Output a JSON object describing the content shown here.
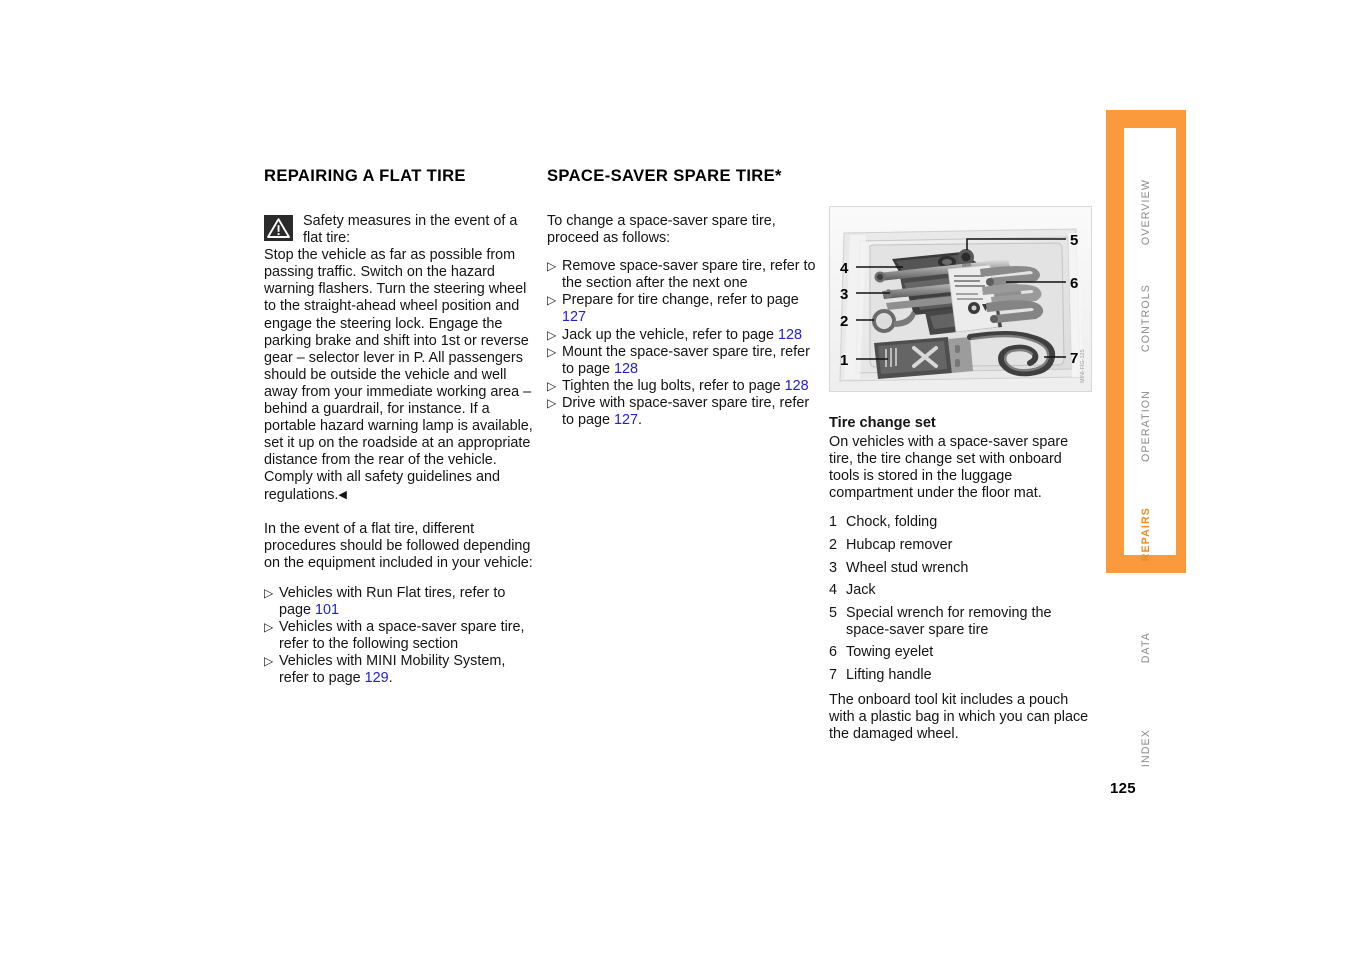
{
  "page": {
    "number": "125"
  },
  "column_1": {
    "title": "REPAIRING A FLAT TIRE",
    "warning": {
      "icon": "warning-triangle-icon",
      "lead": "Safety measures in the event of a flat tire:",
      "body": "Stop the vehicle as far as possible from passing traffic. Switch on the hazard warning flashers.\nTurn the steering wheel to the straight-ahead wheel position and engage the steering lock. Engage the parking brake and shift into 1st or reverse gear – selector lever in P.\nAll passengers should be outside the vehicle and well away from your immediate working area – behind a guardrail, for instance.\nIf a portable hazard warning lamp is available, set it up on the roadside at an appropriate distance from the rear of the vehicle. Comply with all safety guidelines and regulations.",
      "end_marker": "◀"
    },
    "intro": "In the event of a flat tire, different procedures should be followed depending on the equipment included in your vehicle:",
    "bullet_marker": "▷",
    "items": [
      {
        "text_before": "Vehicles with Run Flat tires, refer to page ",
        "link": "101",
        "text_after": ""
      },
      {
        "text_before": "Vehicles with a space-saver spare tire, refer to the following section",
        "link": "",
        "text_after": ""
      },
      {
        "text_before": "Vehicles with MINI Mobility System, refer to page ",
        "link": "129",
        "text_after": "."
      }
    ]
  },
  "column_2": {
    "title": "SPACE-SAVER SPARE TIRE*",
    "intro": "To change a space-saver spare tire, proceed as follows:",
    "bullet_marker": "▷",
    "items": [
      {
        "text_before": "Remove space-saver spare tire, refer to the section after the next one",
        "link": "",
        "text_after": ""
      },
      {
        "text_before": "Prepare for tire change, refer to page ",
        "link": "127",
        "text_after": ""
      },
      {
        "text_before": "Jack up the vehicle, refer to page ",
        "link": "128",
        "text_after": ""
      },
      {
        "text_before": "Mount the space-saver spare tire, refer to page ",
        "link": "128",
        "text_after": ""
      },
      {
        "text_before": "Tighten the lug bolts, refer to page ",
        "link": "128",
        "text_after": ""
      },
      {
        "text_before": "Drive with space-saver spare tire, refer to page ",
        "link": "127",
        "text_after": "."
      }
    ]
  },
  "column_3": {
    "figure": {
      "name": "tire-change-set-photo",
      "callouts": [
        "1",
        "2",
        "3",
        "4",
        "5",
        "6",
        "7"
      ]
    },
    "subtitle": "Tire change set",
    "intro": "On vehicles with a space-saver spare tire, the tire change set with onboard tools is stored in the luggage compartment under the floor mat.",
    "legend": [
      {
        "num": "1",
        "label": "Chock, folding"
      },
      {
        "num": "2",
        "label": "Hubcap remover"
      },
      {
        "num": "3",
        "label": "Wheel stud wrench"
      },
      {
        "num": "4",
        "label": "Jack"
      },
      {
        "num": "5",
        "label": "Special wrench for removing the space-saver spare tire"
      },
      {
        "num": "6",
        "label": "Towing eyelet"
      },
      {
        "num": "7",
        "label": "Lifting handle"
      }
    ],
    "outro": "The onboard tool kit includes a pouch with a plastic bag in which you can place the damaged wheel."
  },
  "nav_rail": {
    "accent_color": "#fb9a3c",
    "active_color": "#f08a22",
    "inactive_color": "#8a8a8a",
    "tabs": [
      {
        "label": "OVERVIEW",
        "active": false
      },
      {
        "label": "CONTROLS",
        "active": false
      },
      {
        "label": "OPERATION",
        "active": false
      },
      {
        "label": "REPAIRS",
        "active": true
      },
      {
        "label": "DATA",
        "active": false
      },
      {
        "label": "INDEX",
        "active": false
      }
    ]
  }
}
